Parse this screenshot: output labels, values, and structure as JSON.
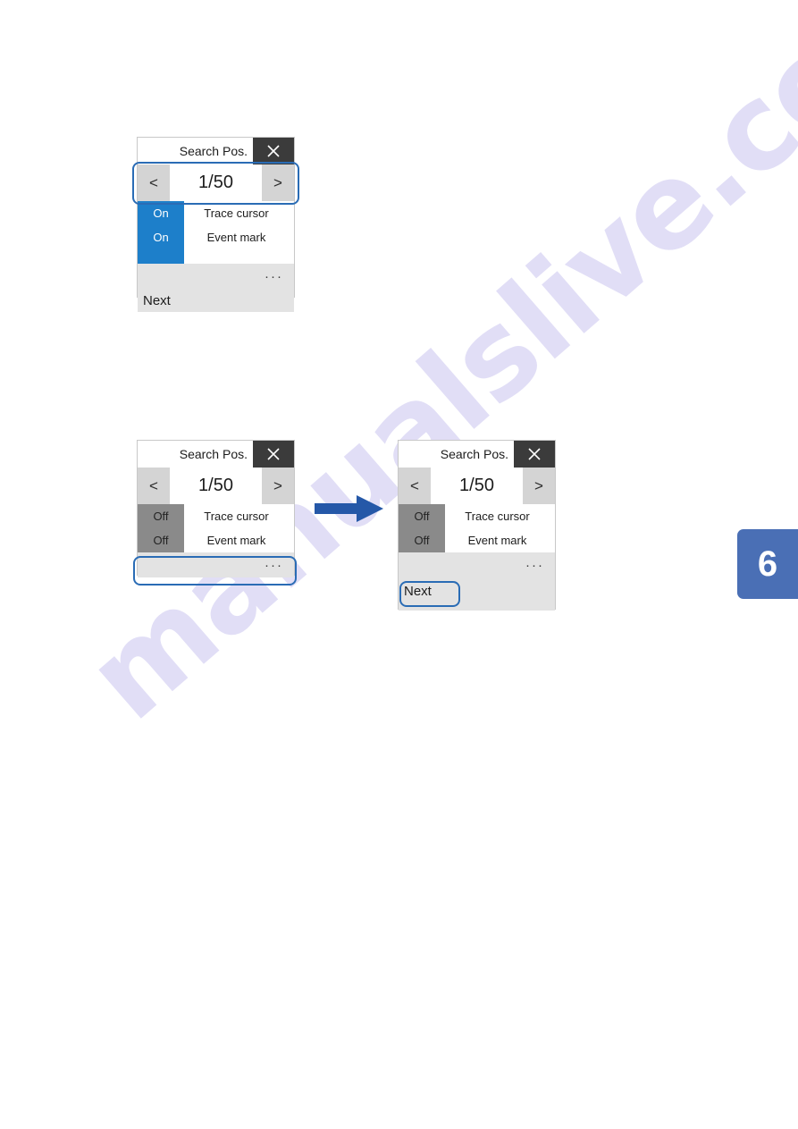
{
  "page": {
    "tab_number": "6",
    "watermark": "manualslive.com",
    "accent_blue": "#1d7fca",
    "highlight_blue": "#2a6cb5",
    "off_gray": "#8a8a8a",
    "arrow_color": "#2558a8",
    "tab_color": "#4a6fb5"
  },
  "panels": [
    {
      "id": "panel-initial",
      "title": "Search Pos.",
      "close_label": "close-icon",
      "nav": {
        "prev_label": "<",
        "value": "1/50",
        "next_label": ">"
      },
      "options": [
        {
          "state": "On",
          "label": "Trace cursor"
        },
        {
          "state": "On",
          "label": "Event mark"
        }
      ],
      "footer": {
        "ellipsis": "···",
        "next_label": "Next"
      }
    },
    {
      "id": "panel-before",
      "title": "Search Pos.",
      "close_label": "close-icon",
      "nav": {
        "prev_label": "<",
        "value": "1/50",
        "next_label": ">"
      },
      "options": [
        {
          "state": "Off",
          "label": "Trace cursor"
        },
        {
          "state": "Off",
          "label": "Event mark"
        }
      ],
      "footer": {
        "ellipsis": "···",
        "next_label": ""
      }
    },
    {
      "id": "panel-after",
      "title": "Search Pos.",
      "close_label": "close-icon",
      "nav": {
        "prev_label": "<",
        "value": "1/50",
        "next_label": ">"
      },
      "options": [
        {
          "state": "Off",
          "label": "Trace cursor"
        },
        {
          "state": "Off",
          "label": "Event mark"
        }
      ],
      "footer": {
        "ellipsis": "···",
        "next_label": "Next"
      }
    }
  ]
}
